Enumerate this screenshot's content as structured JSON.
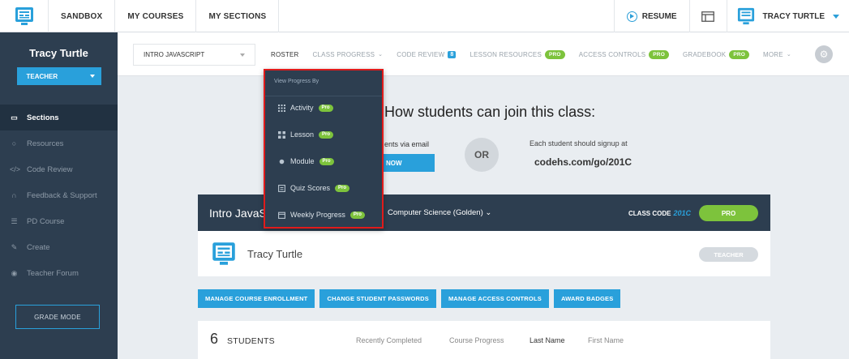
{
  "topbar": {
    "nav": [
      "SANDBOX",
      "MY COURSES",
      "MY SECTIONS"
    ],
    "resume_label": "RESUME",
    "user_name": "TRACY TURTLE"
  },
  "sidebar": {
    "name": "Tracy Turtle",
    "role": "TEACHER",
    "items": [
      {
        "label": "Sections",
        "icon": "sections-icon"
      },
      {
        "label": "Resources",
        "icon": "lightbulb-icon"
      },
      {
        "label": "Code Review",
        "icon": "code-icon"
      },
      {
        "label": "Feedback & Support",
        "icon": "headset-icon"
      },
      {
        "label": "PD Course",
        "icon": "pd-course-icon"
      },
      {
        "label": "Create",
        "icon": "pencil-icon"
      },
      {
        "label": "Teacher Forum",
        "icon": "forum-icon"
      }
    ],
    "grade_mode": "GRADE MODE"
  },
  "subnav": {
    "section_select": "INTRO JAVASCRIPT",
    "tabs": {
      "roster": "ROSTER",
      "class_progress": "CLASS PROGRESS",
      "code_review": "CODE REVIEW",
      "code_review_count": "8",
      "lesson_resources": "LESSON RESOURCES",
      "access_controls": "ACCESS CONTROLS",
      "gradebook": "GRADEBOOK",
      "more": "MORE"
    },
    "pro_badge": "PRO"
  },
  "dropdown": {
    "heading": "View Progress By",
    "items": [
      "Activity",
      "Lesson",
      "Module",
      "Quiz Scores",
      "Weekly Progress"
    ],
    "pro_label": "Pro"
  },
  "join": {
    "title": "How students can join this class:",
    "via_email": "ents via email",
    "now_button": "NOW",
    "or": "OR",
    "signup_text": "Each student should signup at",
    "signup_url": "codehs.com/go/201C"
  },
  "class_card": {
    "title": "Intro JavaS",
    "course": "Computer Science (Golden) ⌄",
    "class_code_label": "CLASS CODE",
    "class_code": "201C",
    "pro": "PRO",
    "teacher_name": "Tracy Turtle",
    "teacher_role": "TEACHER"
  },
  "actions": [
    "MANAGE COURSE ENROLLMENT",
    "CHANGE STUDENT PASSWORDS",
    "MANAGE ACCESS CONTROLS",
    "AWARD BADGES"
  ],
  "students": {
    "count": "6",
    "label": "STUDENTS",
    "sort": [
      "Recently Completed",
      "Course Progress",
      "Last Name",
      "First Name"
    ]
  },
  "colors": {
    "accent": "#29a0db",
    "sidebar": "#2d3e50",
    "pro": "#7dc33c",
    "highlight": "#e01b1b"
  }
}
